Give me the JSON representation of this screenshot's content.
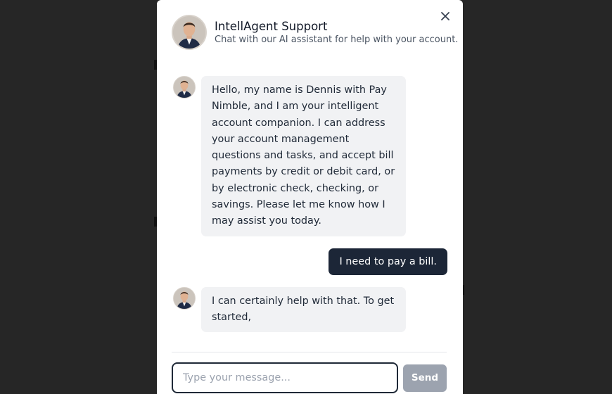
{
  "chat": {
    "title": "IntellAgent Support",
    "subtitle": "Chat with our AI assistant for help with your account.",
    "close_icon": "close-icon",
    "messages": [
      {
        "sender": "agent",
        "text": "Hello, my name is Dennis with Pay Nimble, and I am your intelligent account companion. I can address your account management questions and tasks, and accept bill payments by credit or debit card, or by electronic check, checking, or savings. Please let me know how I may assist you today."
      },
      {
        "sender": "user",
        "text": "I need to pay a bill."
      },
      {
        "sender": "agent",
        "text": "I can certainly help with that. To get started,"
      }
    ],
    "input": {
      "placeholder": "Type your message...",
      "value": ""
    },
    "send_label": "Send"
  },
  "colors": {
    "backdrop": "#262626",
    "user_bubble": "#1c2637",
    "agent_bubble": "#f1f2f4",
    "send_button": "#9ca3af"
  }
}
